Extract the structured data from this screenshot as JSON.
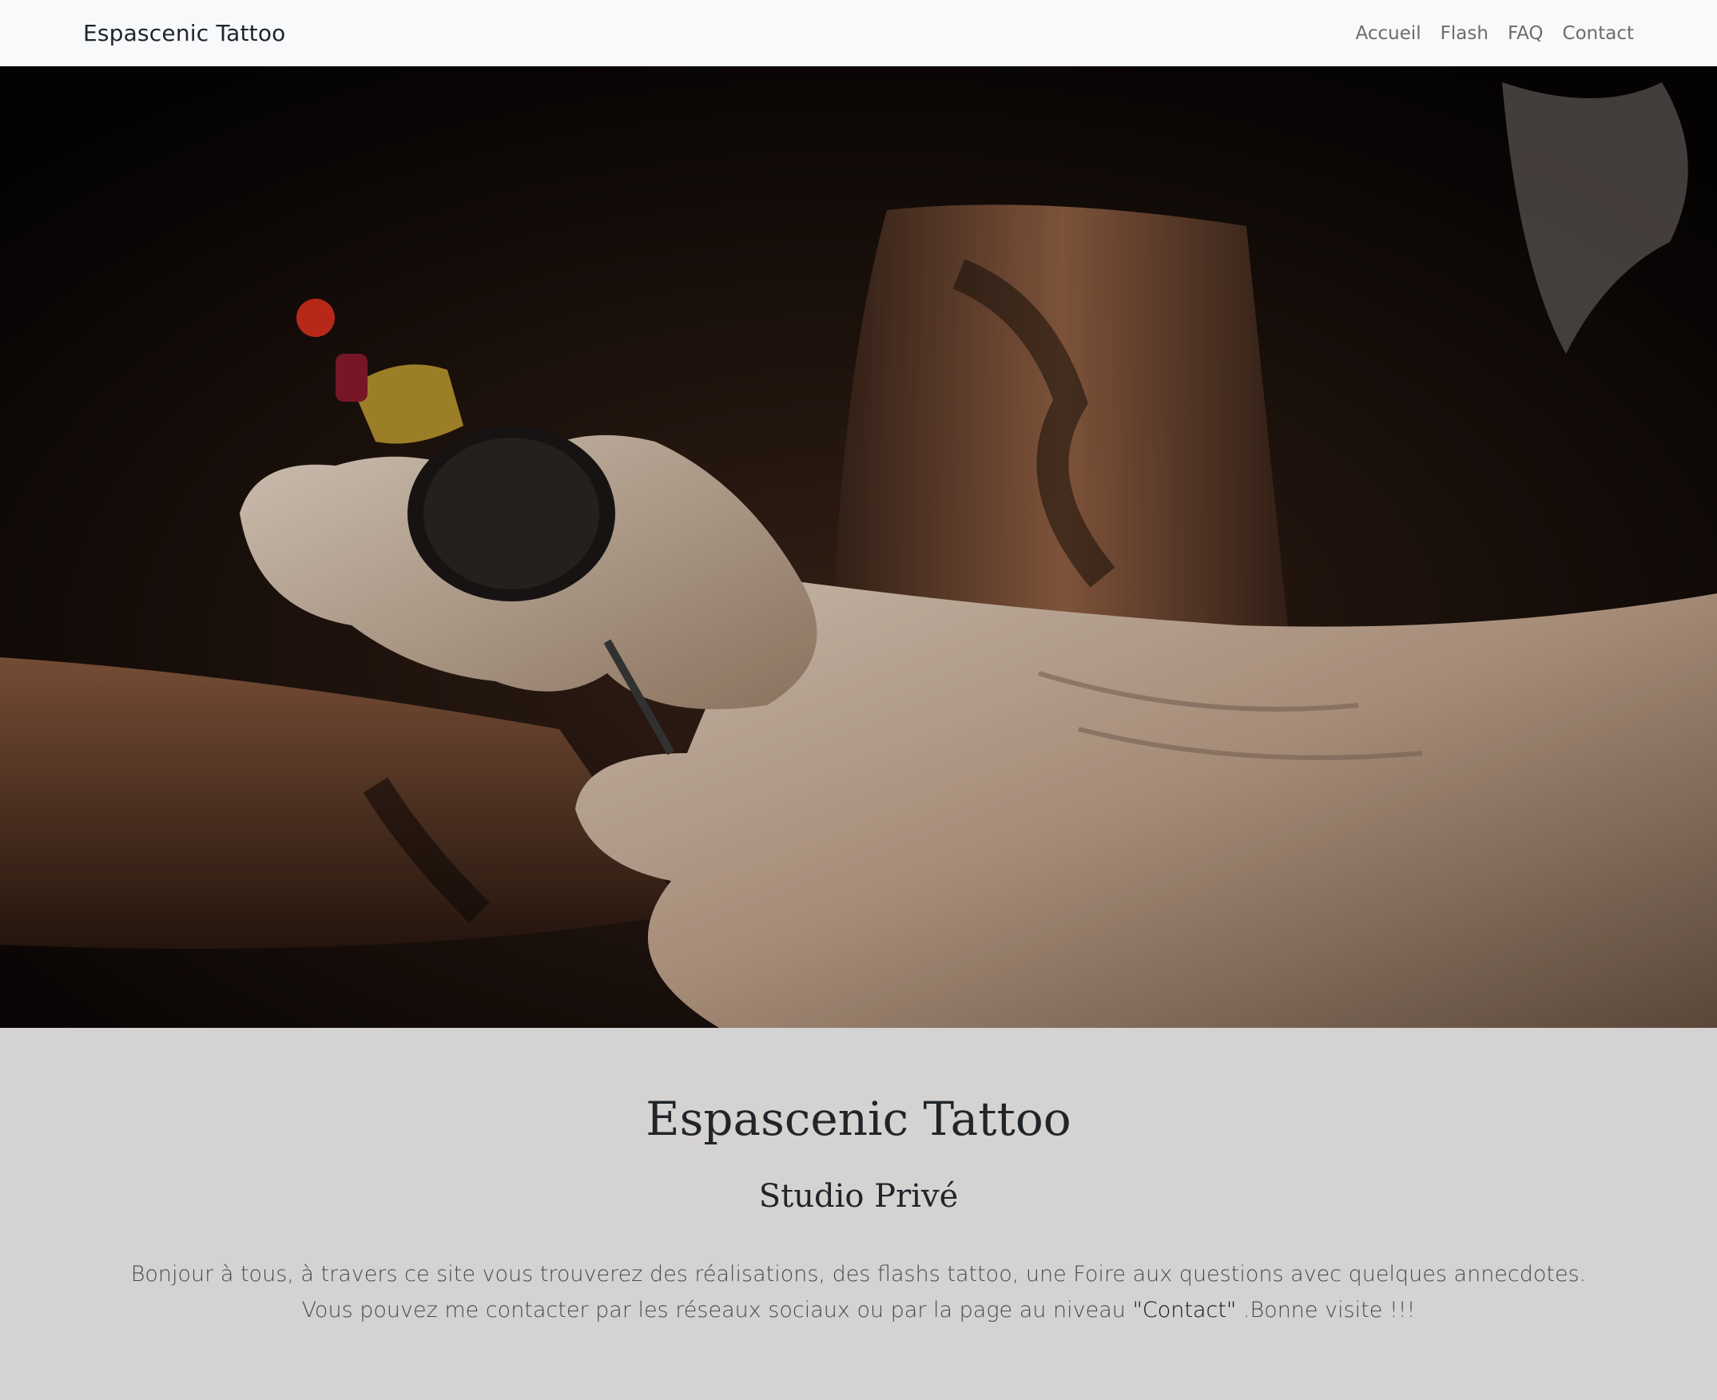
{
  "navbar": {
    "brand": "Espascenic Tattoo",
    "links": [
      "Accueil",
      "Flash",
      "FAQ",
      "Contact"
    ]
  },
  "hero": {
    "image_alt": "Tatoueur ganté tenant une machine à tatouer sur un bras tatoué"
  },
  "main": {
    "title": "Espascenic Tattoo",
    "subtitle": "Studio Privé",
    "intro_before": "Bonjour à tous, à travers ce site vous trouverez des réalisations, des flashs tattoo, une Foire aux questions avec quelques annecdotes. Vous pouvez me contacter par les réseaux sociaux ou par la page au niveau ",
    "intro_link": "\"Contact\"",
    "intro_after": " .Bonne visite !!!"
  },
  "colors": {
    "navbar_bg": "#f8f9fa",
    "content_bg": "#d5d2d2",
    "text": "#212529",
    "nav_link": "#6c6c6c"
  }
}
